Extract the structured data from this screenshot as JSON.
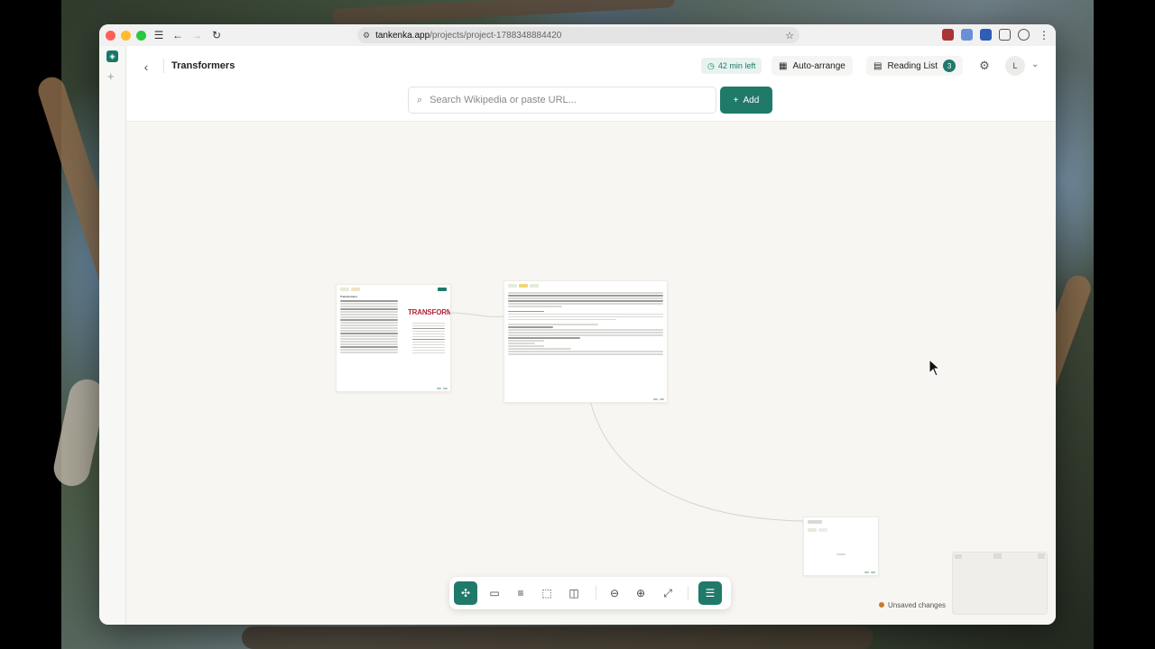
{
  "browser": {
    "url_host": "tankenka.app",
    "url_path": "/projects/project-1788348884420"
  },
  "header": {
    "project_title": "Transformers",
    "time_left": "42 min left",
    "auto_arrange_label": "Auto-arrange",
    "reading_list_label": "Reading List",
    "reading_list_count": "3",
    "avatar_initial": "L"
  },
  "search": {
    "placeholder": "Search Wikipedia or paste URL...",
    "add_label": "Add"
  },
  "canvas": {
    "cards": [
      {
        "title": "Transformers",
        "logo_text": "TRANSFORMERS"
      },
      {
        "title": ""
      },
      {
        "title": ""
      }
    ]
  },
  "toolbar": {
    "tools": [
      "select-tool",
      "comment-tool",
      "text-tool",
      "frame-tool",
      "note-tool",
      "zoom-out",
      "zoom-in",
      "fit-view",
      "panel-toggle"
    ]
  },
  "status": {
    "unsaved_label": "Unsaved changes"
  },
  "colors": {
    "accent": "#1f7a6a",
    "unsaved_dot": "#c9782a",
    "canvas_bg": "#f7f6f2"
  }
}
